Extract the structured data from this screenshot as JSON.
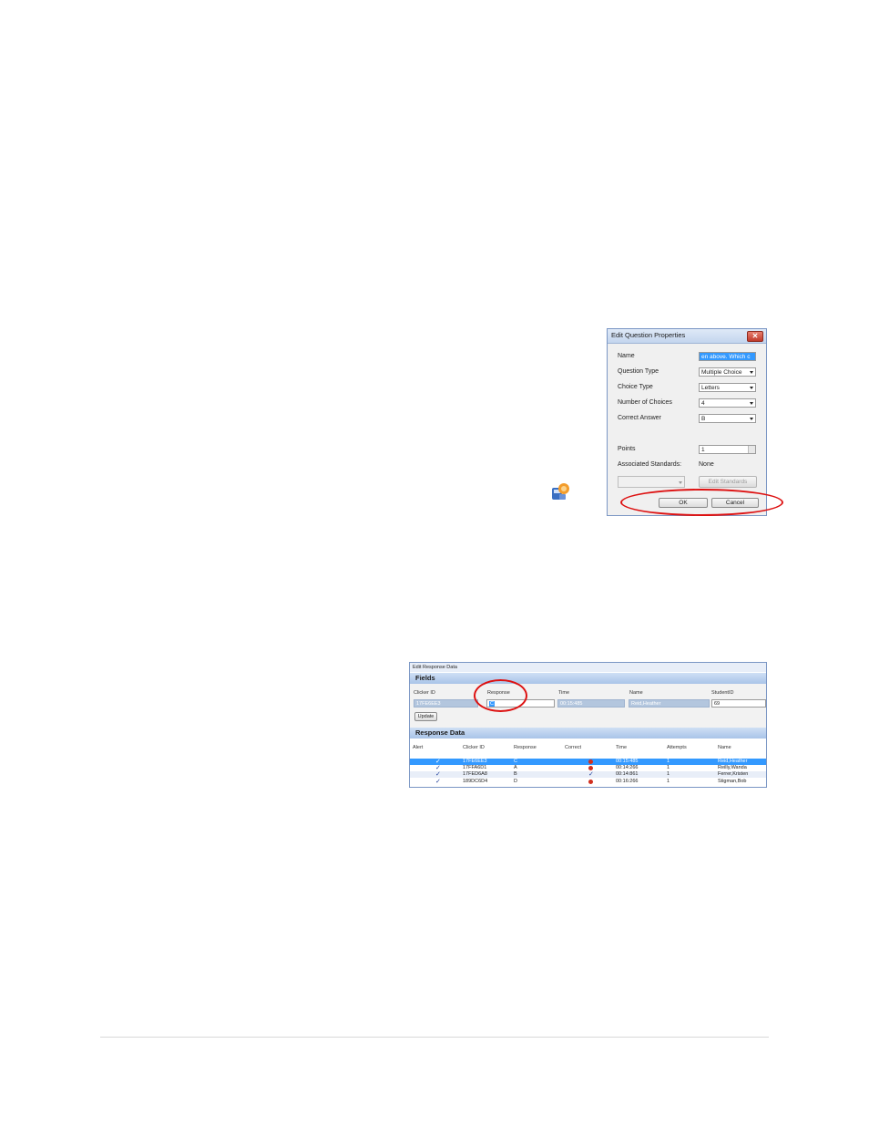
{
  "edit_question_dialog": {
    "title": "Edit Question Properties",
    "close_glyph": "✕",
    "fields": [
      {
        "label": "Name",
        "value": "en above. Which c"
      },
      {
        "label": "Question Type",
        "value": "Multiple Choice"
      },
      {
        "label": "Choice Type",
        "value": "Letters"
      },
      {
        "label": "Number of Choices",
        "value": "4"
      },
      {
        "label": "Correct Answer",
        "value": "B"
      },
      {
        "label": "Points",
        "value": "1"
      },
      {
        "label": "Associated Standards:",
        "value": "None"
      }
    ],
    "edit_standards_label": "Edit Standards",
    "ok_label": "OK",
    "cancel_label": "Cancel"
  },
  "edit_response_panel": {
    "window_title": "Edit Response Data",
    "fields_heading": "Fields",
    "field_labels": {
      "clicker_id": "Clicker ID",
      "response": "Response",
      "time": "Time",
      "name": "Name",
      "student_id": "StudentID"
    },
    "field_values": {
      "clicker_id": "17FE6EE3",
      "response": "C",
      "time": "00:15:485",
      "name": "Reid,Heather",
      "student_id": "69"
    },
    "update_label": "Update",
    "response_heading": "Response Data",
    "columns": [
      "Alert",
      "Clicker ID",
      "Response",
      "Correct",
      "Time",
      "Attempts",
      "Name"
    ],
    "rows": [
      {
        "alert": "✓",
        "clicker_id": "17FE6EE3",
        "response": "C",
        "correct": "incorrect",
        "time": "00:15:485",
        "attempts": "1",
        "name": "Reid,Heather"
      },
      {
        "alert": "✓",
        "clicker_id": "17FFA6D1",
        "response": "A",
        "correct": "incorrect",
        "time": "00:14:266",
        "attempts": "1",
        "name": "Reilly,Wanda"
      },
      {
        "alert": "✓",
        "clicker_id": "17FED6A8",
        "response": "B",
        "correct": "correct",
        "time": "00:14:861",
        "attempts": "1",
        "name": "Ferrer,Kristen"
      },
      {
        "alert": "✓",
        "clicker_id": "189DC6D4",
        "response": "D",
        "correct": "incorrect",
        "time": "00:16:266",
        "attempts": "1",
        "name": "Stigman,Bob"
      }
    ]
  },
  "colors": {
    "highlight_oval": "#dd1111",
    "selection": "#3399ff",
    "header_blue": "#a9c4e8"
  }
}
